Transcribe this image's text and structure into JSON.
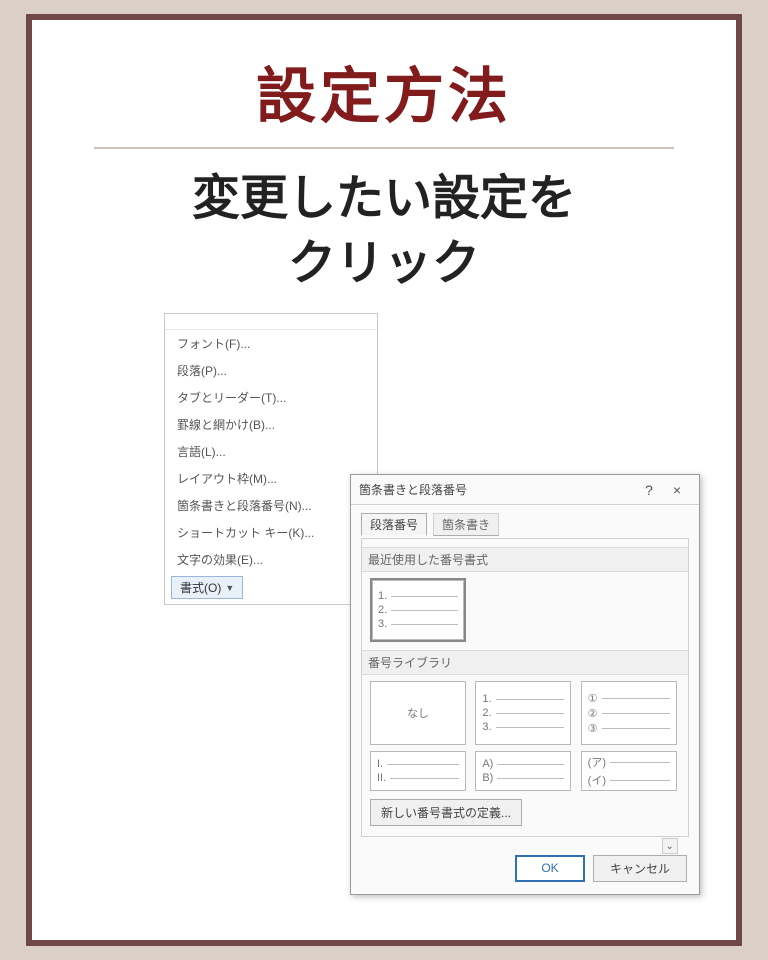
{
  "header": {
    "title": "設定方法",
    "subtitle_l1": "変更したい設定を",
    "subtitle_l2": "クリック"
  },
  "dropdown": {
    "items": [
      "フォント(F)...",
      "段落(P)...",
      "タブとリーダー(T)...",
      "罫線と網かけ(B)...",
      "言語(L)...",
      "レイアウト枠(M)...",
      "箇条書きと段落番号(N)...",
      "ショートカット キー(K)...",
      "文字の効果(E)..."
    ],
    "format_button": "書式(O)"
  },
  "dialog": {
    "title": "箇条書きと段落番号",
    "help": "?",
    "close": "×",
    "tabs": {
      "active": "段落番号",
      "inactive": "箇条書き"
    },
    "recent_label": "最近使用した番号書式",
    "recent_preview": [
      "1.",
      "2.",
      "3."
    ],
    "library_label": "番号ライブラリ",
    "none_label": "なし",
    "lib": {
      "a": [
        "1.",
        "2.",
        "3."
      ],
      "b": [
        "①",
        "②",
        "③"
      ],
      "c": [
        "I.",
        "II."
      ],
      "d": [
        "A)",
        "B)"
      ],
      "e": [
        "(ア)",
        "(イ)"
      ]
    },
    "define": "新しい番号書式の定義...",
    "ok": "OK",
    "cancel": "キャンセル"
  }
}
